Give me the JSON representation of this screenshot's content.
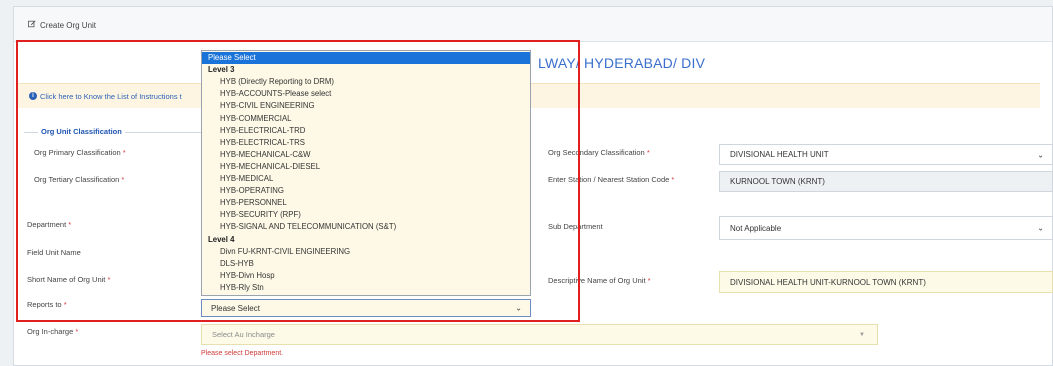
{
  "header": {
    "title": "Create Org Unit",
    "icon": "edit-icon"
  },
  "page_title": "LWAY/ HYDERABAD/ DIV",
  "info_text": "Click here to Know the List of Instructions t",
  "section_legend": "Org Unit Classification",
  "left_labels": {
    "org_primary": "Org Primary Classification",
    "org_tertiary": "Org Tertiary Classification",
    "department": "Department",
    "field_unit": "Field Unit Name",
    "short_name": "Short Name of Org Unit",
    "reports_to": "Reports to",
    "org_incharge": "Org In-charge"
  },
  "right_labels": {
    "org_secondary": "Org Secondary Classification",
    "station": "Enter Station / Nearest Station Code",
    "sub_department": "Sub Department",
    "descriptive_name": "Descriptive Name of Org Unit"
  },
  "right_values": {
    "org_secondary": "DIVISIONAL HEALTH UNIT",
    "station": "KURNOOL TOWN (KRNT)",
    "sub_department": "Not Applicable",
    "descriptive_name": "DIVISIONAL HEALTH UNIT-KURNOOL TOWN (KRNT)"
  },
  "required_marker": "*",
  "dropdown": {
    "options": [
      {
        "label": "Please Select",
        "kind": "selected"
      },
      {
        "label": "Level 3",
        "kind": "group"
      },
      {
        "label": "HYB (Directly Reporting to DRM)",
        "kind": "child"
      },
      {
        "label": "HYB-ACCOUNTS-Please select",
        "kind": "child"
      },
      {
        "label": "HYB-CIVIL ENGINEERING",
        "kind": "child"
      },
      {
        "label": "HYB-COMMERCIAL",
        "kind": "child"
      },
      {
        "label": "HYB-ELECTRICAL-TRD",
        "kind": "child"
      },
      {
        "label": "HYB-ELECTRICAL-TRS",
        "kind": "child"
      },
      {
        "label": "HYB-MECHANICAL-C&W",
        "kind": "child"
      },
      {
        "label": "HYB-MECHANICAL-DIESEL",
        "kind": "child"
      },
      {
        "label": "HYB-MEDICAL",
        "kind": "child"
      },
      {
        "label": "HYB-OPERATING",
        "kind": "child"
      },
      {
        "label": "HYB-PERSONNEL",
        "kind": "child"
      },
      {
        "label": "HYB-SECURITY (RPF)",
        "kind": "child"
      },
      {
        "label": "HYB-SIGNAL AND TELECOMMUNICATION (S&T)",
        "kind": "child"
      },
      {
        "label": "Level 4",
        "kind": "group"
      },
      {
        "label": "Divn FU-KRNT-CIVIL ENGINEERING",
        "kind": "child"
      },
      {
        "label": "DLS-HYB",
        "kind": "child"
      },
      {
        "label": "HYB-Divn Hosp",
        "kind": "child"
      },
      {
        "label": "HYB-Rly Stn",
        "kind": "child"
      }
    ]
  },
  "reports_to_value": "Please Select",
  "org_incharge_placeholder": "Select Au Incharge",
  "error_text": "Please select Department.",
  "colors": {
    "accent": "#1a73d9",
    "error": "#d23b3b",
    "highlight_box": "#e02020"
  }
}
